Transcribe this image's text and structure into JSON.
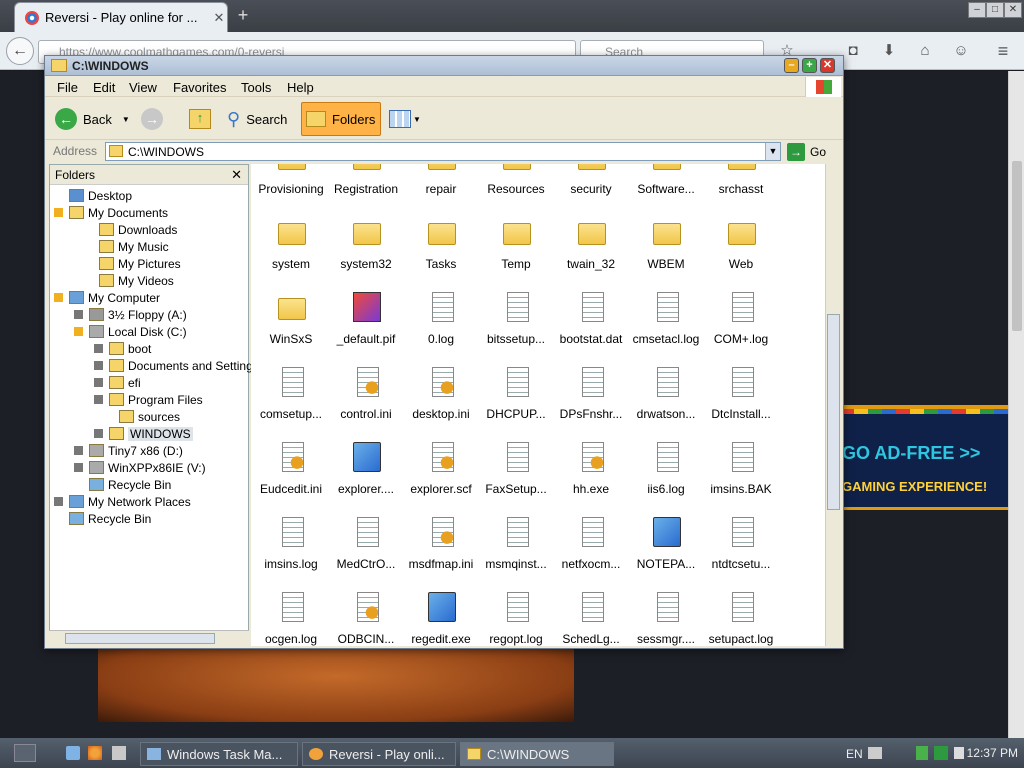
{
  "browser": {
    "tab_title": "Reversi - Play online for ...",
    "url": "https://www.coolmathgames.com/0-reversi",
    "search_placeholder": "Search"
  },
  "ad": {
    "line1": "GO AD-FREE >>",
    "line2": "GAMING EXPERIENCE!"
  },
  "explorer": {
    "title": "C:\\WINDOWS",
    "menu": [
      "File",
      "Edit",
      "View",
      "Favorites",
      "Tools",
      "Help"
    ],
    "toolbar": {
      "back": "Back",
      "search": "Search",
      "folders": "Folders"
    },
    "address_label": "Address",
    "address_value": "C:\\WINDOWS",
    "go": "Go",
    "folders_header": "Folders",
    "tree": [
      {
        "label": "Desktop"
      },
      {
        "label": "My Documents"
      },
      {
        "label": "Downloads"
      },
      {
        "label": "My Music"
      },
      {
        "label": "My Pictures"
      },
      {
        "label": "My Videos"
      },
      {
        "label": "My Computer"
      },
      {
        "label": "3½ Floppy (A:)"
      },
      {
        "label": "Local Disk (C:)"
      },
      {
        "label": "boot"
      },
      {
        "label": "Documents and Settings"
      },
      {
        "label": "efi"
      },
      {
        "label": "Program Files"
      },
      {
        "label": "sources"
      },
      {
        "label": "WINDOWS"
      },
      {
        "label": "Tiny7 x86 (D:)"
      },
      {
        "label": "WinXPPx86IE (V:)"
      },
      {
        "label": "Recycle Bin"
      },
      {
        "label": "My Network Places"
      },
      {
        "label": "Recycle Bin"
      }
    ],
    "files": [
      {
        "name": "Provisioning",
        "icon": "folder-icon"
      },
      {
        "name": "Registration",
        "icon": "folder-icon"
      },
      {
        "name": "repair",
        "icon": "folder-icon"
      },
      {
        "name": "Resources",
        "icon": "folder-icon"
      },
      {
        "name": "security",
        "icon": "folder-icon"
      },
      {
        "name": "Software...",
        "icon": "folder-icon"
      },
      {
        "name": "srchasst",
        "icon": "folder-icon"
      },
      {
        "name": "system",
        "icon": "folder-icon"
      },
      {
        "name": "system32",
        "icon": "folder-icon"
      },
      {
        "name": "Tasks",
        "icon": "folder-icon"
      },
      {
        "name": "Temp",
        "icon": "folder-icon"
      },
      {
        "name": "twain_32",
        "icon": "folder-icon"
      },
      {
        "name": "WBEM",
        "icon": "folder-icon"
      },
      {
        "name": "Web",
        "icon": "folder-icon"
      },
      {
        "name": "WinSxS",
        "icon": "folder-icon"
      },
      {
        "name": "_default.pif",
        "icon": "pif-icon"
      },
      {
        "name": "0.log",
        "icon": "text-file-icon"
      },
      {
        "name": "bitssetup...",
        "icon": "text-file-icon"
      },
      {
        "name": "bootstat.dat",
        "icon": "data-file-icon"
      },
      {
        "name": "cmsetacl.log",
        "icon": "text-file-icon"
      },
      {
        "name": "COM+.log",
        "icon": "text-file-icon"
      },
      {
        "name": "comsetup...",
        "icon": "text-file-icon"
      },
      {
        "name": "control.ini",
        "icon": "ini-file-icon"
      },
      {
        "name": "desktop.ini",
        "icon": "ini-file-icon"
      },
      {
        "name": "DHCPUP...",
        "icon": "text-file-icon"
      },
      {
        "name": "DPsFnshr...",
        "icon": "text-file-icon"
      },
      {
        "name": "drwatson...",
        "icon": "text-file-icon"
      },
      {
        "name": "DtcInstall...",
        "icon": "text-file-icon"
      },
      {
        "name": "Eudcedit.ini",
        "icon": "ini-file-icon"
      },
      {
        "name": "explorer....",
        "icon": "exe-icon"
      },
      {
        "name": "explorer.scf",
        "icon": "search-file-icon"
      },
      {
        "name": "FaxSetup...",
        "icon": "text-file-icon"
      },
      {
        "name": "hh.exe",
        "icon": "help-exe-icon"
      },
      {
        "name": "iis6.log",
        "icon": "text-file-icon"
      },
      {
        "name": "imsins.BAK",
        "icon": "data-file-icon"
      },
      {
        "name": "imsins.log",
        "icon": "text-file-icon"
      },
      {
        "name": "MedCtrO...",
        "icon": "text-file-icon"
      },
      {
        "name": "msdfmap.ini",
        "icon": "ini-file-icon"
      },
      {
        "name": "msmqinst...",
        "icon": "text-file-icon"
      },
      {
        "name": "netfxocm...",
        "icon": "text-file-icon"
      },
      {
        "name": "NOTEPA...",
        "icon": "notepad-icon"
      },
      {
        "name": "ntdtcsetu...",
        "icon": "text-file-icon"
      },
      {
        "name": "ocgen.log",
        "icon": "text-file-icon"
      },
      {
        "name": "ODBCIN...",
        "icon": "ini-file-icon"
      },
      {
        "name": "regedit.exe",
        "icon": "regedit-icon"
      },
      {
        "name": "regopt.log",
        "icon": "text-file-icon"
      },
      {
        "name": "SchedLg...",
        "icon": "text-file-icon"
      },
      {
        "name": "sessmgr....",
        "icon": "text-file-icon"
      },
      {
        "name": "setupact.log",
        "icon": "text-file-icon"
      }
    ]
  },
  "taskbar": {
    "tasks": [
      "Windows Task Ma...",
      "Reversi - Play onli...",
      "C:\\WINDOWS"
    ],
    "lang": "EN",
    "clock": "12:37 PM"
  }
}
